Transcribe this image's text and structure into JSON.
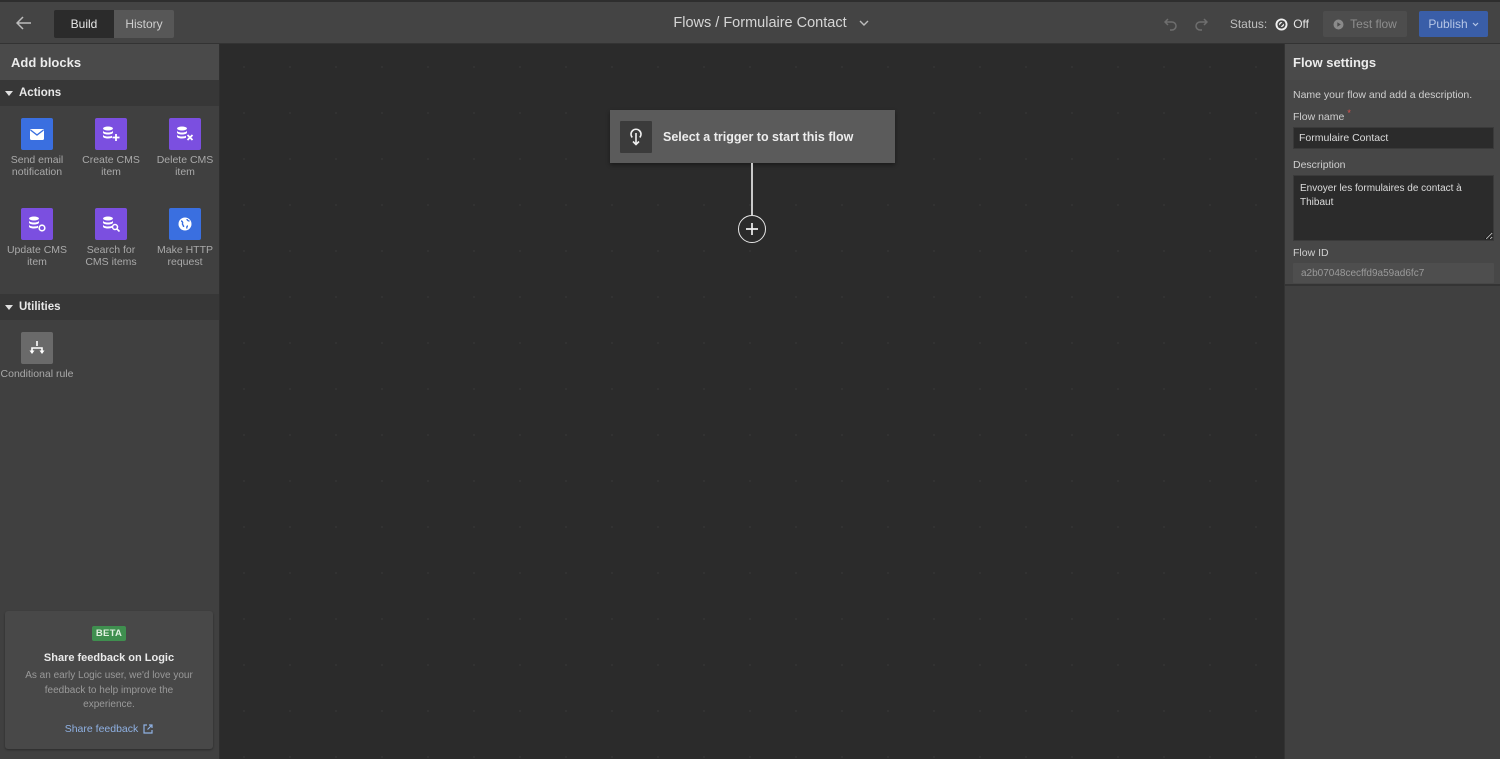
{
  "topbar": {
    "tabs": [
      {
        "label": "Build",
        "active": true
      },
      {
        "label": "History",
        "active": false
      }
    ],
    "title": "Flows / Formulaire Contact",
    "status_label": "Status:",
    "status_value": "Off",
    "test_flow_label": "Test flow",
    "publish_label": "Publish",
    "colors": {
      "publish": "#3a5ea8"
    }
  },
  "left_panel": {
    "title": "Add blocks",
    "sections": [
      {
        "label": "Actions",
        "blocks": [
          {
            "label": "Send email notification",
            "icon": "email-icon",
            "color": "#3a6fe0"
          },
          {
            "label": "Create CMS item",
            "icon": "database-plus-icon",
            "color": "#7b4fe0"
          },
          {
            "label": "Delete CMS item",
            "icon": "database-x-icon",
            "color": "#7b4fe0"
          },
          {
            "label": "Update CMS item",
            "icon": "database-refresh-icon",
            "color": "#7b4fe0"
          },
          {
            "label": "Search for CMS items",
            "icon": "database-search-icon",
            "color": "#7b4fe0"
          },
          {
            "label": "Make HTTP request",
            "icon": "globe-icon",
            "color": "#3a6fe0"
          }
        ]
      },
      {
        "label": "Utilities",
        "blocks": [
          {
            "label": "Conditional rule",
            "icon": "branch-icon",
            "color": "#6a6a6a"
          }
        ]
      }
    ],
    "feedback": {
      "badge": "BETA",
      "title": "Share feedback on Logic",
      "text": "As an early Logic user, we'd love your feedback to help improve the experience.",
      "link": "Share feedback"
    }
  },
  "canvas": {
    "trigger_label": "Select a trigger to start this flow"
  },
  "right_panel": {
    "title": "Flow settings",
    "hint": "Name your flow and add a description.",
    "flow_name_label": "Flow name",
    "required_mark": "*",
    "flow_name_value": "Formulaire Contact",
    "description_label": "Description",
    "description_value": "Envoyer les formulaires de contact à Thibaut",
    "flow_id_label": "Flow ID",
    "flow_id_value": "a2b07048cecffd9a59ad6fc7"
  }
}
